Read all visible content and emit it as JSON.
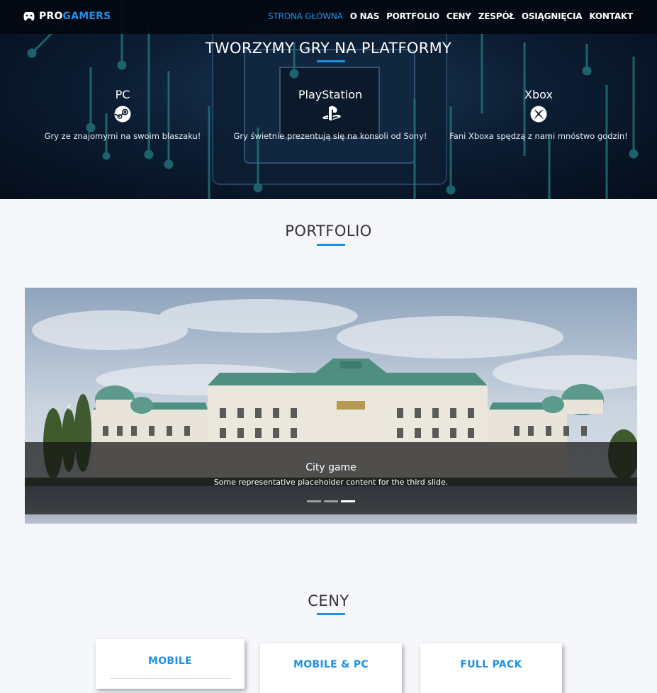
{
  "brand": {
    "pro": "PRO",
    "gamers": "GAMERS",
    "accent": "#1e90e6"
  },
  "nav": {
    "items": [
      {
        "label": "STRONA GŁÓWNA",
        "active": true
      },
      {
        "label": "O NAS"
      },
      {
        "label": "PORTFOLIO"
      },
      {
        "label": "CENY"
      },
      {
        "label": "ZESPÓŁ"
      },
      {
        "label": "OSIĄGNIĘCIA"
      },
      {
        "label": "KONTAKT"
      }
    ]
  },
  "hero": {
    "title": "TWORZYMY GRY NA PLATFORMY",
    "platforms": [
      {
        "name": "PC",
        "icon": "steam-icon",
        "desc": "Gry ze znajomymi na swoim blaszaku!"
      },
      {
        "name": "PlayStation",
        "icon": "playstation-icon",
        "desc": "Gry świetnie prezentują się na konsoli od Sony!"
      },
      {
        "name": "Xbox",
        "icon": "xbox-icon",
        "desc": "Fani Xboxa spędzą z nami mnóstwo godzin!"
      }
    ]
  },
  "portfolio": {
    "title": "PORTFOLIO",
    "carousel": {
      "caption_title": "City game",
      "caption_text": "Some representative placeholder content for the third slide.",
      "slide_count": 3,
      "active_slide": 3
    }
  },
  "pricing": {
    "title": "CENY",
    "cards": [
      {
        "title": "MOBILE"
      },
      {
        "title": "MOBILE & PC"
      },
      {
        "title": "FULL PACK"
      }
    ]
  }
}
